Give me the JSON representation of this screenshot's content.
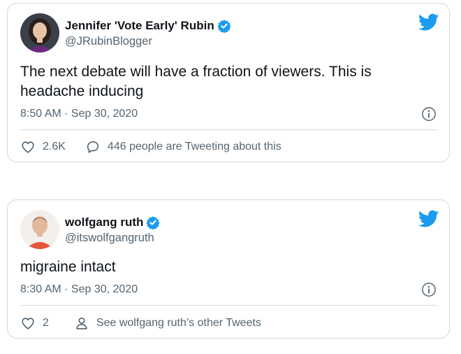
{
  "tweets": [
    {
      "name": "Jennifer 'Vote Early' Rubin",
      "handle": "@JRubinBlogger",
      "text": "The next debate will have a fraction of viewers. This is headache inducing",
      "time": "8:50 AM · Sep 30, 2020",
      "likes": "2.6K",
      "secondary_action": "446 people are Tweeting about this"
    },
    {
      "name": "wolfgang ruth",
      "handle": "@itswolfgangruth",
      "text": "migraine intact",
      "time": "8:30 AM · Sep 30, 2020",
      "likes": "2",
      "secondary_action": "See wolfgang ruth’s other Tweets"
    }
  ],
  "icons": {
    "verified": "verified-badge-icon",
    "brand": "twitter-bird-icon",
    "info": "info-icon",
    "like": "heart-icon",
    "reply": "speech-bubble-icon",
    "profile": "person-icon"
  },
  "colors": {
    "twitter_blue": "#1d9bf0",
    "text_primary": "#0f1419",
    "text_secondary": "#536471",
    "border": "#cfd9de"
  }
}
